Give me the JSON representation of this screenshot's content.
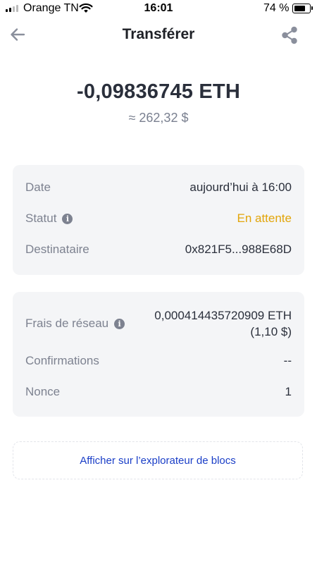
{
  "status_bar": {
    "carrier": "Orange TN",
    "time": "16:01",
    "battery_percent": "74 %",
    "battery_level": 0.74
  },
  "header": {
    "title": "Transférer",
    "back_icon": "arrow-left-icon",
    "share_icon": "share-icon"
  },
  "amount": {
    "crypto": "-0,09836745 ETH",
    "fiat": "≈ 262,32 $"
  },
  "details": [
    {
      "label": "Date",
      "value": "aujourd’hui à 16:00"
    },
    {
      "label": "Statut",
      "value": "En attente"
    },
    {
      "label": "Destinataire",
      "value": "0x821F5...988E68D"
    }
  ],
  "fees": {
    "network_fee_label": "Frais de réseau",
    "network_fee_value_line1": "0,000414435720909 ETH",
    "network_fee_value_line2": "(1,10 $)",
    "confirmations_label": "Confirmations",
    "confirmations_value": "--",
    "nonce_label": "Nonce",
    "nonce_value": "1"
  },
  "explorer_link": "Afficher sur l’explorateur de blocs",
  "colors": {
    "pending": "#e2a50a",
    "link": "#1a3ec7",
    "card_bg": "#f4f5f7"
  }
}
